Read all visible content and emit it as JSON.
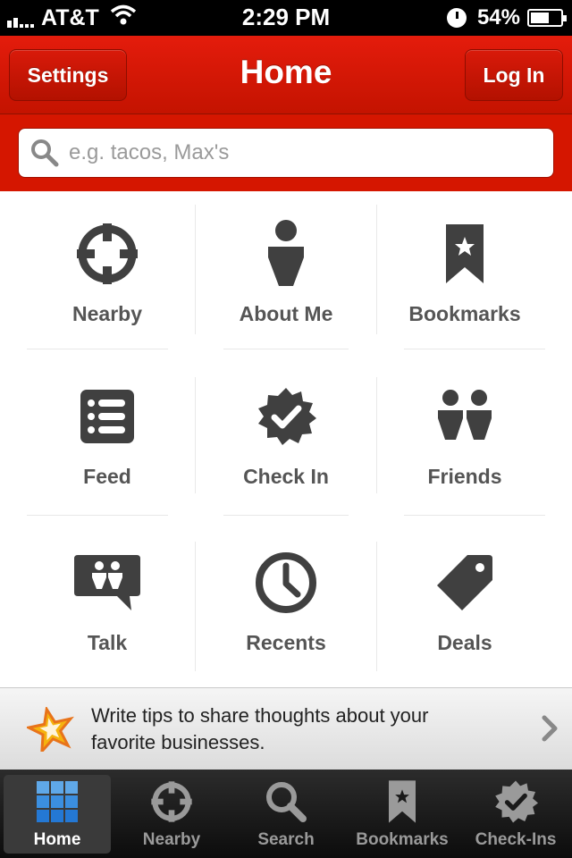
{
  "status_bar": {
    "carrier": "AT&T",
    "time": "2:29 PM",
    "battery": "54%"
  },
  "nav": {
    "title": "Home",
    "left_button": "Settings",
    "right_button": "Log In"
  },
  "search": {
    "placeholder": "e.g. tacos, Max's",
    "value": ""
  },
  "grid": [
    {
      "label": "Nearby",
      "icon": "crosshair-icon"
    },
    {
      "label": "About Me",
      "icon": "person-icon"
    },
    {
      "label": "Bookmarks",
      "icon": "bookmark-icon"
    },
    {
      "label": "Feed",
      "icon": "list-icon"
    },
    {
      "label": "Check In",
      "icon": "checkin-badge-icon"
    },
    {
      "label": "Friends",
      "icon": "friends-icon"
    },
    {
      "label": "Talk",
      "icon": "talk-bubble-icon"
    },
    {
      "label": "Recents",
      "icon": "clock-icon"
    },
    {
      "label": "Deals",
      "icon": "tag-icon"
    }
  ],
  "tip": {
    "text": "Write tips to share thoughts about your favorite businesses.",
    "icon": "star-icon"
  },
  "tab_bar": [
    {
      "label": "Home",
      "icon": "grid-icon",
      "active": true
    },
    {
      "label": "Nearby",
      "icon": "crosshair-icon",
      "active": false
    },
    {
      "label": "Search",
      "icon": "search-icon",
      "active": false
    },
    {
      "label": "Bookmarks",
      "icon": "bookmark-icon",
      "active": false
    },
    {
      "label": "Check-Ins",
      "icon": "checkin-badge-icon",
      "active": false
    }
  ],
  "colors": {
    "brand_red": "#d51600",
    "icon_gray": "#404040",
    "label_gray": "#555555"
  }
}
